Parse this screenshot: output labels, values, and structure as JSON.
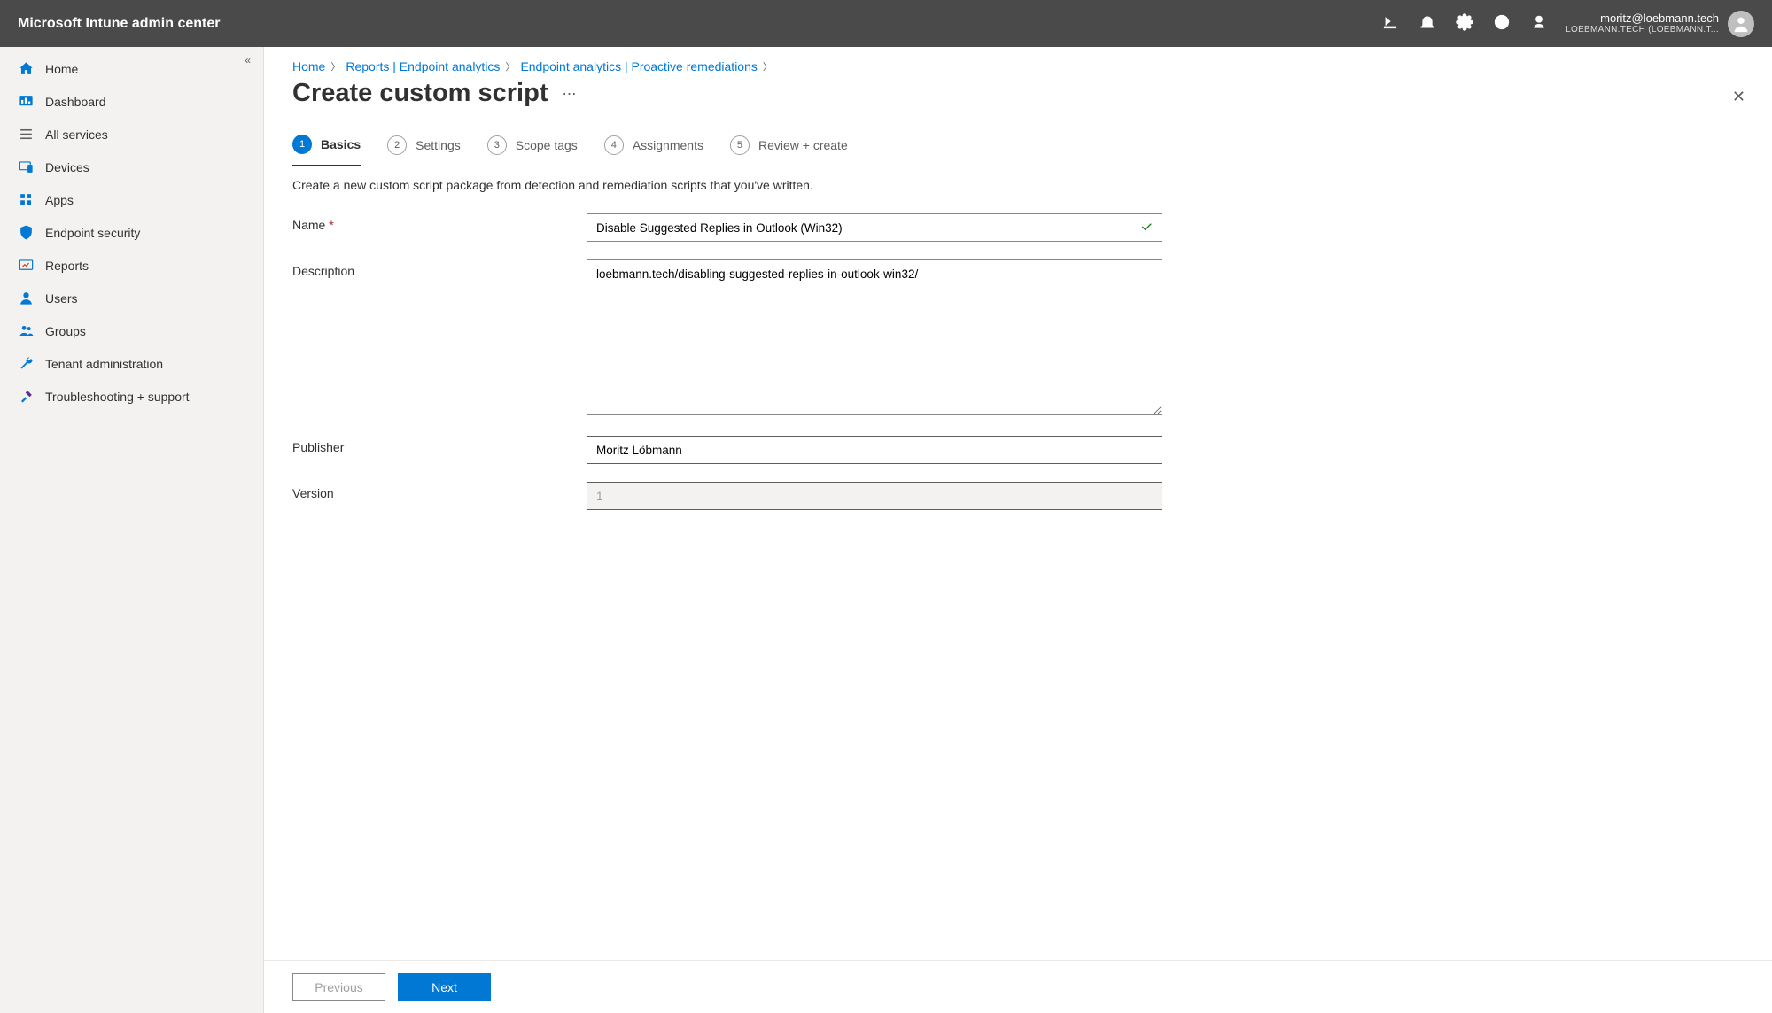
{
  "header": {
    "app_title": "Microsoft Intune admin center",
    "user_email": "moritz@loebmann.tech",
    "tenant": "LOEBMANN.TECH (LOEBMANN.T..."
  },
  "sidebar": {
    "items": [
      {
        "label": "Home"
      },
      {
        "label": "Dashboard"
      },
      {
        "label": "All services"
      },
      {
        "label": "Devices"
      },
      {
        "label": "Apps"
      },
      {
        "label": "Endpoint security"
      },
      {
        "label": "Reports"
      },
      {
        "label": "Users"
      },
      {
        "label": "Groups"
      },
      {
        "label": "Tenant administration"
      },
      {
        "label": "Troubleshooting + support"
      }
    ]
  },
  "breadcrumb": {
    "items": [
      "Home",
      "Reports | Endpoint analytics",
      "Endpoint analytics | Proactive remediations"
    ]
  },
  "page": {
    "title": "Create custom script",
    "subtitle": "Create a new custom script package from detection and remediation scripts that you've written."
  },
  "wizard": {
    "tabs": [
      {
        "num": "1",
        "label": "Basics"
      },
      {
        "num": "2",
        "label": "Settings"
      },
      {
        "num": "3",
        "label": "Scope tags"
      },
      {
        "num": "4",
        "label": "Assignments"
      },
      {
        "num": "5",
        "label": "Review + create"
      }
    ]
  },
  "form": {
    "name_label": "Name",
    "name_value": "Disable Suggested Replies in Outlook (Win32)",
    "description_label": "Description",
    "description_value": "loebmann.tech/disabling-suggested-replies-in-outlook-win32/",
    "publisher_label": "Publisher",
    "publisher_value": "Moritz Löbmann",
    "version_label": "Version",
    "version_value": "1"
  },
  "footer": {
    "previous": "Previous",
    "next": "Next"
  }
}
